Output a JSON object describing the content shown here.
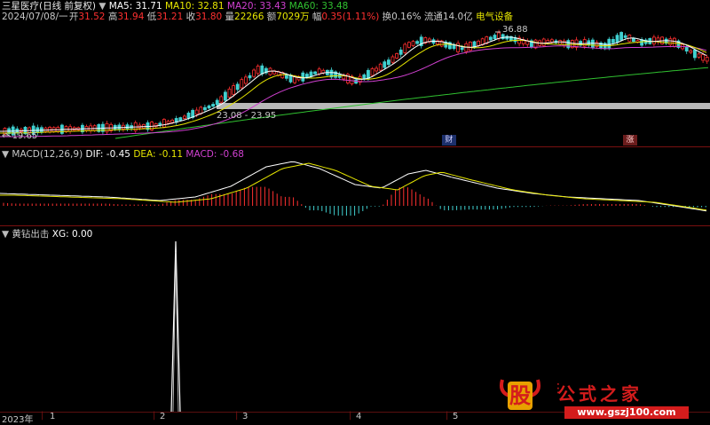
{
  "header": {
    "stock_title": "三星医疗(日线 前复权)",
    "ma5": "MA5: 31.71",
    "ma10": "MA10: 32.81",
    "ma20": "MA20: 33.43",
    "ma60": "MA60: 33.48",
    "date": "2024/07/08/一",
    "open_label": "开",
    "open": "31.52",
    "high_label": "高",
    "high": "31.94",
    "low_label": "低",
    "low": "31.21",
    "close_label": "收",
    "close": "31.80",
    "vol_label": "量",
    "vol": "22266",
    "amount_label": "额",
    "amount": "7029万",
    "change_label": "幅",
    "change": "0.35(1.11%)",
    "turnover": "换0.16%",
    "float_cap": "流通14.0亿",
    "sector": "电气设备"
  },
  "price_panel": {
    "high_marker": "36.88",
    "low_marker": "19.65",
    "range_label": "23.08 - 23.95",
    "badge_finance": "财",
    "badge_rise": "涨"
  },
  "macd_panel": {
    "title": "MACD(12,26,9)",
    "dif": "DIF: -0.45",
    "dea": "DEA: -0.11",
    "macd": "MACD: -0.68"
  },
  "signal_panel": {
    "title": "黄钻出击",
    "xg": "XG: 0.00"
  },
  "time_axis": {
    "labels": [
      "2023年",
      "1",
      "2",
      "3",
      "4",
      "5"
    ]
  },
  "watermark": {
    "logo_char": "股",
    "site_name": "公式之家",
    "url": "www.gszj100.com"
  },
  "colors": {
    "ma5": "#ffffff",
    "ma10": "#e6e600",
    "ma20": "#d040d0",
    "ma60": "#30c030",
    "up": "#ff3030",
    "down": "#40d0d0",
    "macd_label": "#d040d0",
    "separator": "#7a1010",
    "watermark_red": "#d41c1c"
  }
}
